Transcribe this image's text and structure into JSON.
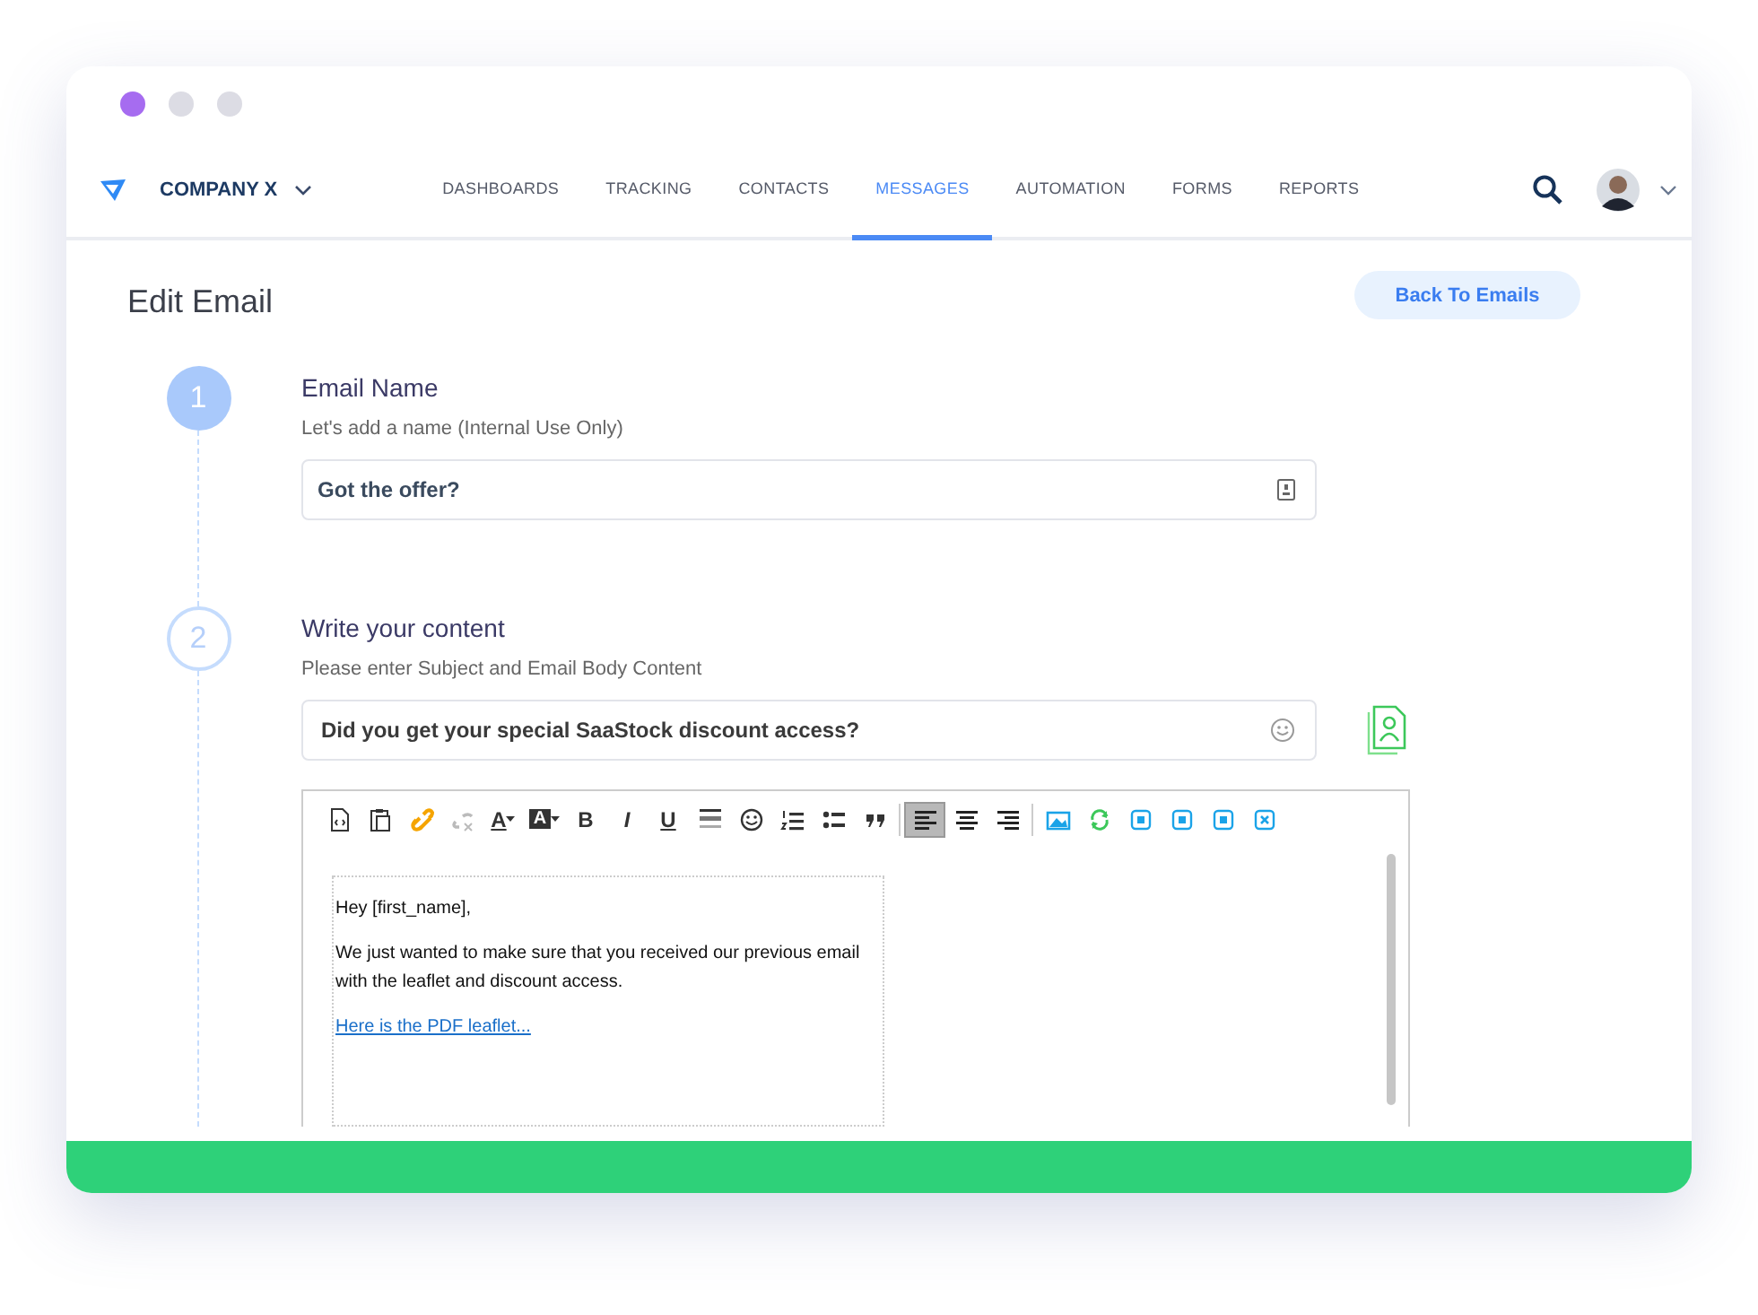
{
  "window": {
    "dots": [
      {
        "color": "#a66cf0"
      },
      {
        "color": "#dcdce4"
      },
      {
        "color": "#dcdce4"
      }
    ]
  },
  "nav": {
    "company": "COMPANY X",
    "items": [
      {
        "label": "DASHBOARDS",
        "selected": false
      },
      {
        "label": "TRACKING",
        "selected": false
      },
      {
        "label": "CONTACTS",
        "selected": false
      },
      {
        "label": "MESSAGES",
        "selected": true
      },
      {
        "label": "AUTOMATION",
        "selected": false
      },
      {
        "label": "FORMS",
        "selected": false
      },
      {
        "label": "REPORTS",
        "selected": false
      }
    ]
  },
  "page": {
    "title": "Edit Email",
    "back_button": "Back To Emails"
  },
  "steps": [
    {
      "number": "1",
      "filled": true,
      "title": "Email Name",
      "hint": "Let's add a name (Internal Use Only)",
      "field_value": "Got the offer?",
      "kind": "name"
    },
    {
      "number": "2",
      "filled": false,
      "title": "Write your content",
      "hint": "Please enter Subject and Email Body Content",
      "field_value": "Did you get your special SaaStock discount access?",
      "kind": "subject"
    }
  ],
  "toolbar": [
    {
      "kind": "source",
      "active": false
    },
    {
      "kind": "paste",
      "active": false
    },
    {
      "kind": "link",
      "active": false
    },
    {
      "kind": "unlink",
      "active": false
    },
    {
      "kind": "text-color",
      "label": "A",
      "active": false
    },
    {
      "kind": "bg-color",
      "label": "A",
      "active": false
    },
    {
      "kind": "bold",
      "label": "B",
      "active": false
    },
    {
      "kind": "italic",
      "label": "I",
      "active": false
    },
    {
      "kind": "underline",
      "label": "U",
      "active": false
    },
    {
      "kind": "rule",
      "active": false
    },
    {
      "kind": "emoji",
      "active": false
    },
    {
      "kind": "ol",
      "active": false
    },
    {
      "kind": "ul",
      "active": false
    },
    {
      "kind": "quote",
      "active": false
    },
    {
      "kind": "align-left",
      "active": true
    },
    {
      "kind": "align-center",
      "active": false
    },
    {
      "kind": "align-right",
      "active": false
    },
    {
      "kind": "image",
      "active": false
    },
    {
      "kind": "refresh",
      "active": false
    },
    {
      "kind": "block",
      "active": false
    },
    {
      "kind": "block",
      "active": false
    },
    {
      "kind": "block",
      "active": false
    },
    {
      "kind": "block-x",
      "active": false
    }
  ],
  "editor": {
    "greeting": "Hey [first_name],",
    "paragraph": "We just wanted to make sure that you received our previous email with the leaflet and discount access.",
    "link": "Here is the PDF leaflet..."
  }
}
